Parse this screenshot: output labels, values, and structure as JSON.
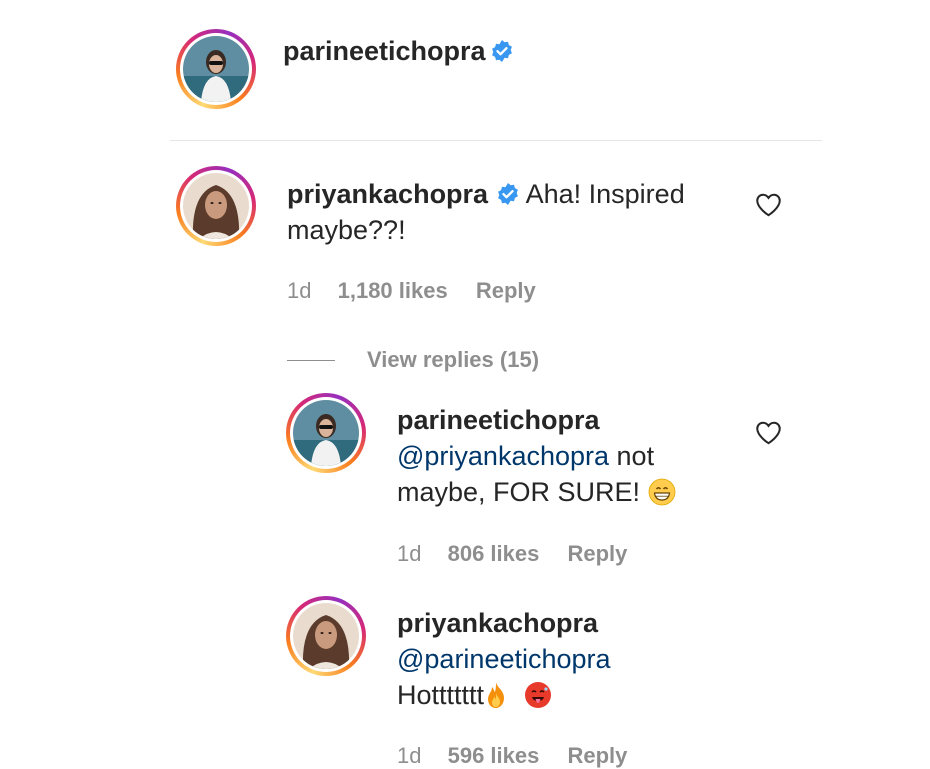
{
  "post": {
    "author": "parineetichopra",
    "verified": true
  },
  "comments": [
    {
      "username": "priyankachopra",
      "verified": true,
      "text_line1": "Aha! Inspired",
      "text_line2": "maybe??!",
      "time": "1d",
      "likes": "1,180 likes",
      "reply_label": "Reply",
      "heart_icon": "heart-outline-icon"
    }
  ],
  "view_replies": "View replies (15)",
  "replies": [
    {
      "username": "parineetichopra",
      "mention": "@priyankachopra",
      "text_after_mention": " not",
      "text_line2": "maybe, FOR SURE! ",
      "emoji": "grinning-face-icon",
      "time": "1d",
      "likes": "806 likes",
      "reply_label": "Reply",
      "heart_icon": "heart-outline-icon"
    },
    {
      "username": "priyankachopra",
      "mention": "@parineetichopra",
      "text_line2": "Hottttttt",
      "emoji1": "fire-icon",
      "emoji2": "hot-face-icon",
      "time": "1d",
      "likes": "596 likes",
      "reply_label": "Reply"
    }
  ],
  "colors": {
    "verified_blue": "#3897f0",
    "meta_gray": "#8e8e8e",
    "mention_blue": "#00376b"
  }
}
